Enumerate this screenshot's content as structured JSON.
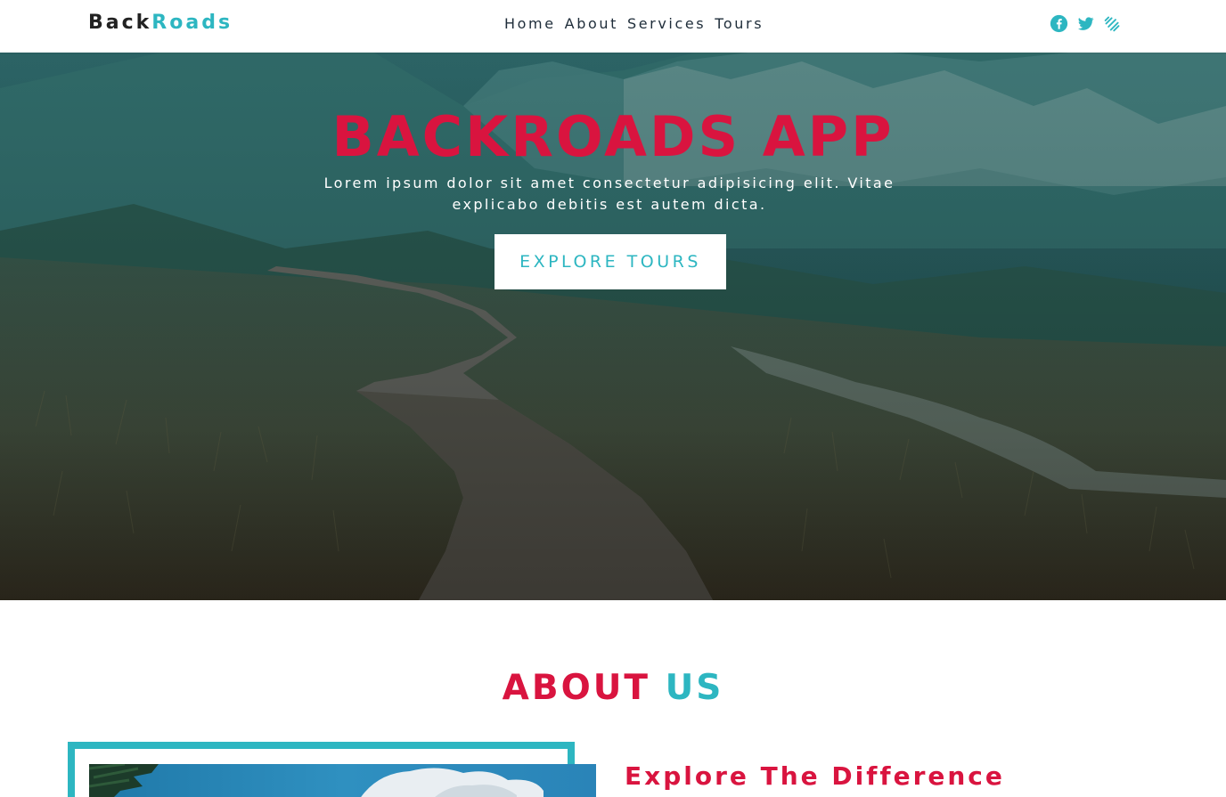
{
  "brand": {
    "part1": "Back",
    "part2": "Roads",
    "accent_color": "#2db6c1",
    "dark_color": "#222222"
  },
  "nav": {
    "links": [
      "Home",
      "About",
      "Services",
      "Tours"
    ]
  },
  "socials": [
    "facebook-icon",
    "twitter-icon",
    "squarespace-icon"
  ],
  "hero": {
    "title": "BACKROADS APP",
    "subtitle": "Lorem ipsum dolor sit amet consectetur adipisicing elit. Vitae explicabo debitis est autem dicta.",
    "button": "EXPLORE TOURS",
    "title_color": "#d9143f"
  },
  "about": {
    "title_part1": "ABOUT",
    "title_part2": "US",
    "subtitle": "Explore The Difference"
  }
}
